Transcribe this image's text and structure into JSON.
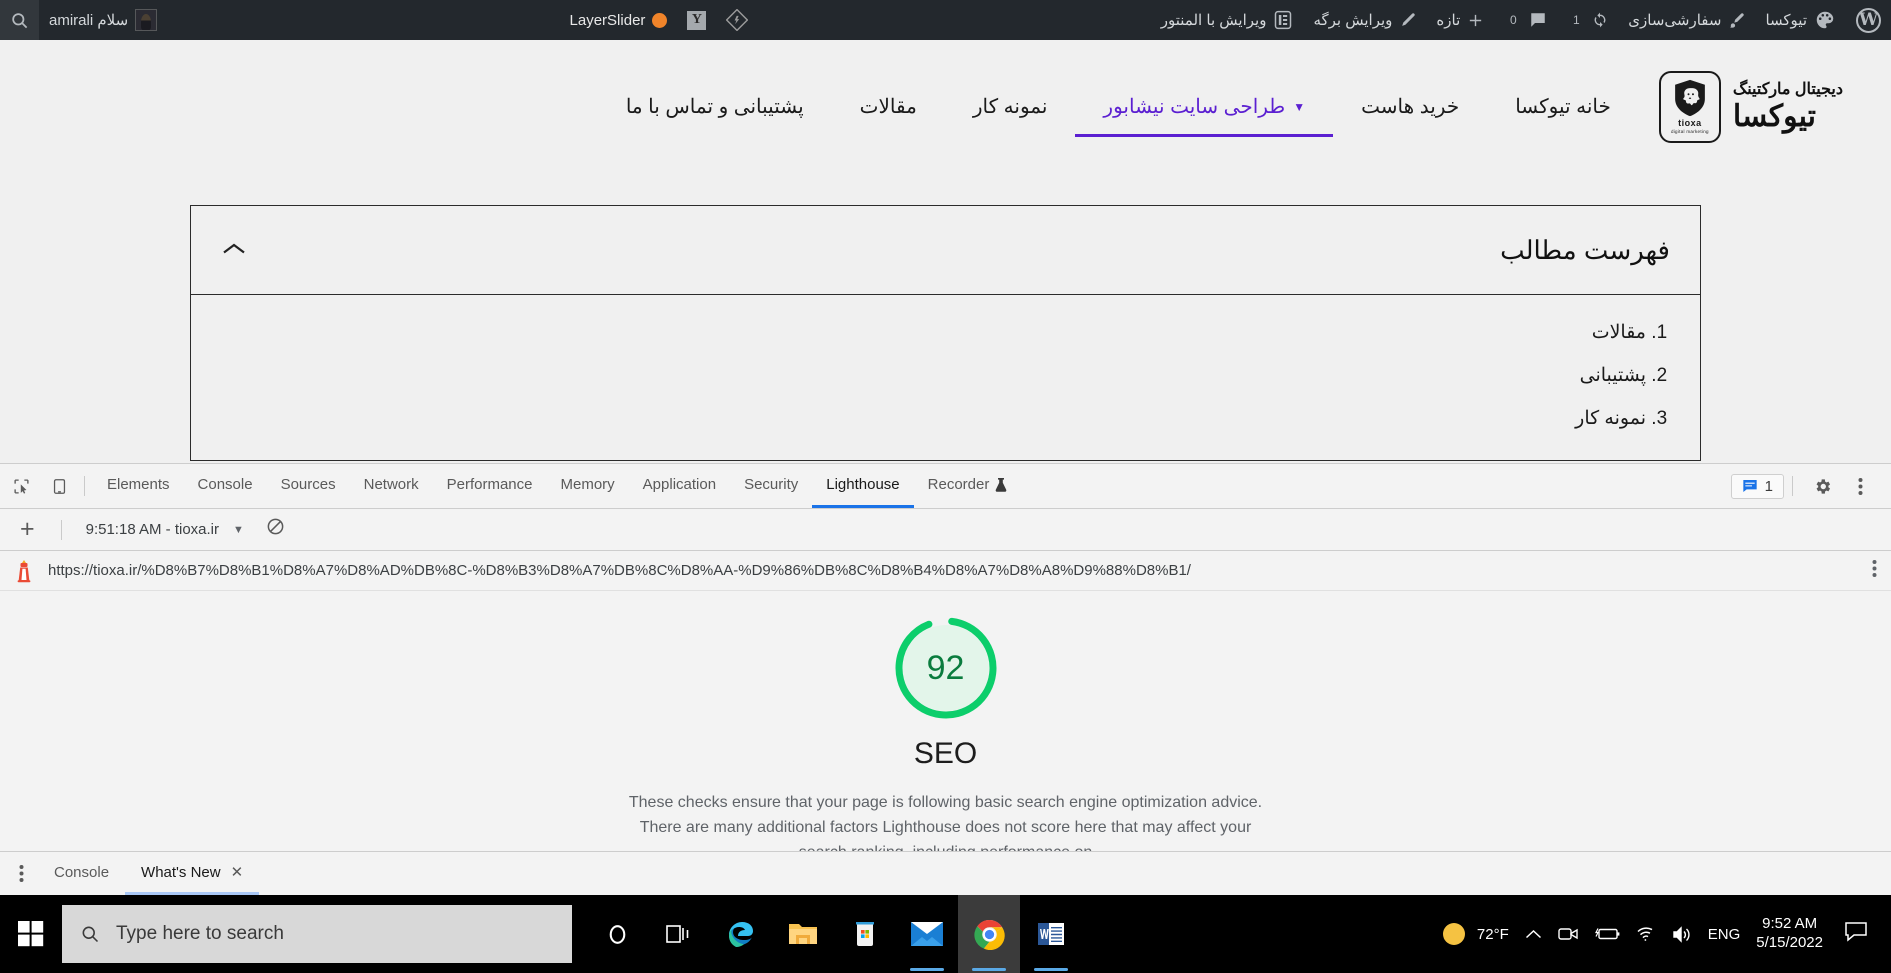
{
  "adminbar": {
    "greeting": "سلام amirali",
    "search_icon": "search-icon",
    "items_right": [
      {
        "label": "تیوکسا",
        "icon": "palette-icon"
      },
      {
        "label": "سفارشی‌سازی",
        "icon": "brush-icon"
      },
      {
        "label": "1",
        "icon": "updates-icon"
      },
      {
        "label": "0",
        "icon": "comment-icon"
      },
      {
        "label": "تازه",
        "icon": "plus-icon"
      },
      {
        "label": "ویرایش برگه",
        "icon": "page-icon"
      },
      {
        "label": "ویرایش با المنتور",
        "icon": "elementor-icon"
      }
    ],
    "layerslider_label": "LayerSlider"
  },
  "site": {
    "logo": {
      "brand_top": "دیجیتال مارکتینگ",
      "brand_bottom": "تیوکسا",
      "mark_text": "tioxa",
      "mark_sub": "digital marketing"
    },
    "nav": [
      {
        "label": "خانه تیوکسا",
        "active": false,
        "has_caret": false
      },
      {
        "label": "خرید هاست",
        "active": false,
        "has_caret": false
      },
      {
        "label": "طراحی سایت نیشابور",
        "active": true,
        "has_caret": true
      },
      {
        "label": "نمونه کار",
        "active": false,
        "has_caret": false
      },
      {
        "label": "مقالات",
        "active": false,
        "has_caret": false
      },
      {
        "label": "پشتیبانی و تماس با ما",
        "active": false,
        "has_caret": false
      }
    ],
    "toc": {
      "title": "فهرست مطالب",
      "items": [
        "مقالات",
        "پشتیبانی",
        "نمونه کار"
      ]
    },
    "whatsapp_label": "whatsapp-icon",
    "accent_color": "#5b1fd1"
  },
  "devtools": {
    "tabs": [
      {
        "label": "Elements",
        "active": false
      },
      {
        "label": "Console",
        "active": false
      },
      {
        "label": "Sources",
        "active": false
      },
      {
        "label": "Network",
        "active": false
      },
      {
        "label": "Performance",
        "active": false
      },
      {
        "label": "Memory",
        "active": false
      },
      {
        "label": "Application",
        "active": false
      },
      {
        "label": "Security",
        "active": false
      },
      {
        "label": "Lighthouse",
        "active": true
      },
      {
        "label": "Recorder",
        "active": false,
        "icon": "experiment-icon"
      }
    ],
    "messages_count": "1",
    "lighthouse": {
      "new_report_label": "+",
      "run_selected": "9:51:18 AM - tioxa.ir",
      "clear_icon": "no-entry-icon",
      "url": "https://tioxa.ir/%D8%B7%D8%B1%D8%A7%D8%AD%DB%8C-%D8%B3%D8%A7%DB%8C%D8%AA-%D9%86%DB%8C%D8%B4%D8%A7%D8%A8%D9%88%D8%B1/",
      "score": "92",
      "score_value": 92,
      "category": "SEO",
      "score_color": "#0cce6b",
      "description": "These checks ensure that your page is following basic search engine optimization advice. There are many additional factors Lighthouse does not score here that may affect your search ranking, including performance on"
    },
    "drawer_tabs": [
      {
        "label": "Console",
        "active": false,
        "closable": false
      },
      {
        "label": "What's New",
        "active": true,
        "closable": true
      }
    ],
    "drawer_close_icon": "close-icon"
  },
  "taskbar": {
    "search_placeholder": "Type here to search",
    "apps": [
      {
        "name": "cortana-icon"
      },
      {
        "name": "task-view-icon"
      },
      {
        "name": "edge-icon"
      },
      {
        "name": "file-explorer-icon"
      },
      {
        "name": "microsoft-store-icon"
      },
      {
        "name": "mail-icon"
      },
      {
        "name": "chrome-icon"
      },
      {
        "name": "word-icon"
      }
    ],
    "weather": "72°F",
    "language": "ENG",
    "time": "9:52 AM",
    "date": "5/15/2022"
  }
}
